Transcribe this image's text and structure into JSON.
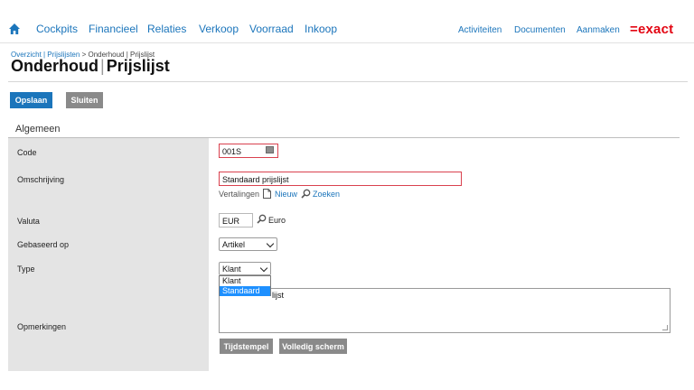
{
  "nav": {
    "items": [
      {
        "label": "Cockpits"
      },
      {
        "label": "Financieel"
      },
      {
        "label": "Relaties"
      },
      {
        "label": "Verkoop"
      },
      {
        "label": "Voorraad"
      },
      {
        "label": "Inkoop"
      }
    ],
    "right": [
      {
        "label": "Activiteiten"
      },
      {
        "label": "Documenten"
      },
      {
        "label": "Aanmaken"
      }
    ],
    "logo": "=exact"
  },
  "breadcrumb": {
    "link": "Overzicht | Prijslijsten",
    "separator": ">",
    "current": "Onderhoud | Prijslijst"
  },
  "page_title": {
    "main": "Onderhoud",
    "sep": "|",
    "sub": "Prijslijst"
  },
  "toolbar": {
    "save_label": "Opslaan",
    "close_label": "Sluiten"
  },
  "section": {
    "title": "Algemeen"
  },
  "fields": {
    "code": {
      "label": "Code",
      "value": "001S"
    },
    "description": {
      "label": "Omschrijving",
      "value": "Standaard prijslijst",
      "translations": "Vertalingen",
      "new_link": "Nieuw",
      "search_link": "Zoeken"
    },
    "currency": {
      "label": "Valuta",
      "value": "EUR",
      "name": "Euro"
    },
    "based_on": {
      "label": "Gebaseerd op",
      "value": "Artikel"
    },
    "type": {
      "label": "Type",
      "value": "Klant",
      "options": [
        "Klant",
        "Standaard"
      ],
      "highlighted": "Standaard"
    },
    "remarks": {
      "label": "Opmerkingen",
      "value_visible": "lijst",
      "timestamp_button": "Tijdstempel",
      "fullscreen_button": "Volledig scherm"
    }
  },
  "colors": {
    "accent": "#1b75bb",
    "brand": "#e30613",
    "required_border": "#d9414e",
    "label_bg": "#e4e4e4"
  }
}
